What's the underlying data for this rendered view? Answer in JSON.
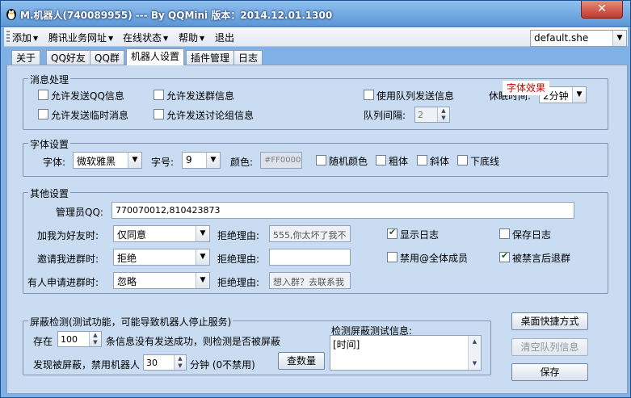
{
  "window": {
    "title": "M.机器人(740089955) --- By QQMini 版本：2014.12.01.1300",
    "close_label": "✕"
  },
  "menu": {
    "add": "添加",
    "tencent_urls": "腾讯业务网址",
    "online_status": "在线状态",
    "help": "帮助",
    "exit": "退出",
    "profile": "default.she"
  },
  "tabs": [
    "关于",
    "QQ好友",
    "QQ群",
    "机器人设置",
    "插件管理",
    "日志"
  ],
  "message": {
    "title": "消息处理",
    "allow_qq": "允许发送QQ信息",
    "allow_group": "允许发送群信息",
    "allow_temp": "允许发送临时消息",
    "allow_discuss": "允许发送讨论组信息",
    "use_queue": "使用队列发送信息",
    "sleep_label": "休眠时间:",
    "sleep_value": "2分钟",
    "queue_label": "队列间隔:",
    "queue_value": "2"
  },
  "font": {
    "title": "字体设置",
    "font_label": "字体:",
    "font_value": "微软雅黑",
    "size_label": "字号:",
    "size_value": "9",
    "color_label": "颜色:",
    "color_value": "#FF0000",
    "random_color": "随机颜色",
    "bold": "粗体",
    "italic": "斜体",
    "underline": "下底线",
    "effect": "字体效果"
  },
  "other": {
    "title": "其他设置",
    "admin_label": "管理员QQ:",
    "admin_value": "770070012,810423873",
    "friend_label": "加我为好友时:",
    "friend_value": "仅同意",
    "invite_label": "邀请我进群时:",
    "invite_value": "拒绝",
    "apply_label": "有人申请进群时:",
    "apply_value": "忽略",
    "reject_label": "拒绝理由:",
    "reject_friend": "555,你太坏了我不",
    "reject_invite": "",
    "reject_apply": "想入群？去联系我",
    "show_log": "显示日志",
    "save_log": "保存日志",
    "ban_at_all": "禁用@全体成员",
    "leave_when_banned": "被禁言后退群"
  },
  "shield": {
    "title": "屏蔽检测(测试功能，可能导致机器人停止服务)",
    "exist_label": "存在",
    "count_value": "100",
    "count_suffix": "条信息没有发送成功，则检测是否被屏蔽",
    "ban_prefix": "发现被屏蔽，禁用机器人",
    "minutes_value": "30",
    "ban_suffix": "分钟 (0不禁用)",
    "check_button": "查数量",
    "test_info_label": "检测屏蔽测试信息:",
    "test_info_value": "[时间]"
  },
  "buttons": {
    "desktop_shortcut": "桌面快捷方式",
    "clear_queue": "清空队列信息",
    "save": "保存"
  },
  "colors": {
    "window_bg": "#7fb1e6",
    "panel_bg": "#c9dcf1",
    "effect_text": "#d20000"
  }
}
